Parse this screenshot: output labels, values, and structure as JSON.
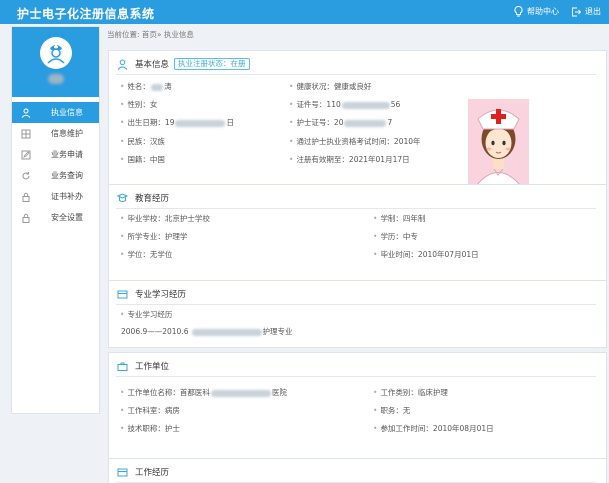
{
  "app": {
    "title": "护士电子化注册信息系统"
  },
  "topbar": {
    "help_label": "帮助中心",
    "logout_label": "退出"
  },
  "sidebar": {
    "items": [
      {
        "label": "执业信息",
        "icon": "user-icon",
        "active": true
      },
      {
        "label": "信息维护",
        "icon": "grid-icon",
        "active": false
      },
      {
        "label": "业务申请",
        "icon": "edit-icon",
        "active": false
      },
      {
        "label": "业务查询",
        "icon": "refresh-icon",
        "active": false
      },
      {
        "label": "证书补办",
        "icon": "lock-icon",
        "active": false
      },
      {
        "label": "安全设置",
        "icon": "lock-icon",
        "active": false
      }
    ]
  },
  "breadcrumb": "当前位置: 首页» 执业信息",
  "basic": {
    "title": "基本信息",
    "status": "执业注册状态：在册",
    "fields": {
      "name": "姓名：",
      "name_tail": "涛",
      "gender": "性别：女",
      "birth": "出生日期：19",
      "birth_tail": "日",
      "ethnicity": "民族：汉族",
      "nationality": "国籍：中国",
      "health": "健康状况：健康或良好",
      "id_no": "证件号：110",
      "id_tail": "56",
      "cert_no": "护士证号：20",
      "cert_tail": "7",
      "exam": "通过护士执业资格考试时间：2010年",
      "expire": "注册有效期至：2021年01月17日"
    }
  },
  "education": {
    "title": "教育经历",
    "school": "毕业学校：北京护士学校",
    "major": "所学专业：护理学",
    "degree": "学位：无学位",
    "duration": "学制：四年制",
    "level": "学历：中专",
    "grad_time": "毕业时间：2010年07月01日"
  },
  "study": {
    "title": "专业学习经历",
    "label": "专业学习经历",
    "period": "2006.9——2010.6",
    "major_tail": "护理专业"
  },
  "work": {
    "title": "工作单位",
    "unit": "工作单位名称：首都医科",
    "unit_tail": "医院",
    "dept": "工作科室：病房",
    "title_pos": "技术职称：护士",
    "category": "工作类别：临床护理",
    "duty": "职务：无",
    "start_time": "参加工作时间：2010年08月01日"
  },
  "work_history": {
    "title": "工作经历"
  },
  "colors": {
    "brand": "#2a9ce0",
    "tag": "#5bc0de",
    "cross": "#e02020"
  }
}
